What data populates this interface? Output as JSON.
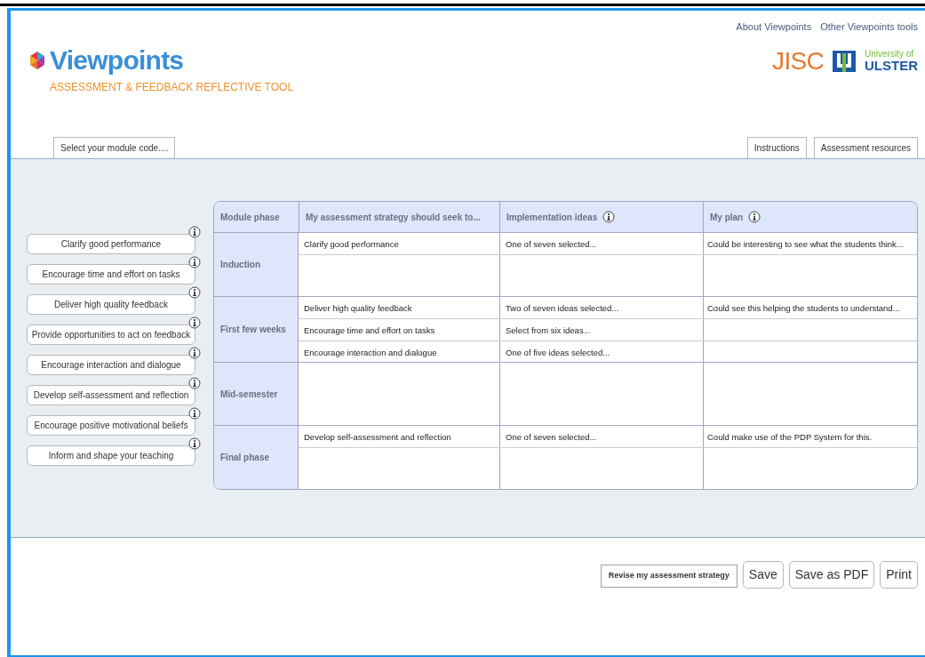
{
  "header": {
    "links": [
      "About Viewpoints",
      "Other Viewpoints tools"
    ],
    "logo": {
      "name": "Viewpoints",
      "subtitle": "ASSESSMENT & FEEDBACK REFLECTIVE TOOL"
    },
    "partners": {
      "jisc": "JISC",
      "university_line1": "University of",
      "university_line2": "ULSTER"
    }
  },
  "tabs_left": [
    "Select your module code...."
  ],
  "tabs_right": [
    "Instructions",
    "Assessment resources"
  ],
  "principles": [
    {
      "label": "Clarify good performance"
    },
    {
      "label": "Encourage time and effort on tasks"
    },
    {
      "label": "Deliver high quality feedback"
    },
    {
      "label": "Provide opportunities to act on feedback"
    },
    {
      "label": "Encourage interaction and dialogue"
    },
    {
      "label": "Develop self-assessment and reflection"
    },
    {
      "label": "Encourage positive motivational beliefs"
    },
    {
      "label": "Inform and shape your teaching"
    }
  ],
  "table": {
    "columns": [
      {
        "label": "Module phase",
        "info": false
      },
      {
        "label": "My assessment strategy should seek to...",
        "info": false
      },
      {
        "label": "Implementation ideas",
        "info": true
      },
      {
        "label": "My plan",
        "info": true
      }
    ],
    "phases": [
      {
        "name": "Induction",
        "rows": [
          {
            "strategy": "Clarify good performance",
            "ideas": "One of seven selected...",
            "plan": "Could be interesting to see what the students think..."
          },
          {}
        ]
      },
      {
        "name": "First few weeks",
        "rows": [
          {
            "strategy": "Deliver high quality feedback",
            "ideas": "Two of seven ideas selected...",
            "plan": "Could see this helping the students to understand..."
          },
          {
            "strategy": "Encourage time and effort on tasks",
            "ideas": "Select from six ideas..."
          },
          {
            "strategy": "Encourage interaction and dialogue",
            "ideas": "One of five ideas selected..."
          }
        ]
      },
      {
        "name": "Mid-semester",
        "rows": [
          {}
        ]
      },
      {
        "name": "Final phase",
        "rows": [
          {
            "strategy": "Develop self-assessment and reflection",
            "ideas": "One of seven selected...",
            "plan": "Could make use of the PDP System for this."
          },
          {}
        ]
      }
    ]
  },
  "actions": [
    {
      "label": "Revise my assessment strategy",
      "kind": "primary"
    },
    {
      "label": "Save",
      "kind": "large"
    },
    {
      "label": "Save as PDF",
      "kind": "large"
    },
    {
      "label": "Print",
      "kind": "large"
    }
  ]
}
